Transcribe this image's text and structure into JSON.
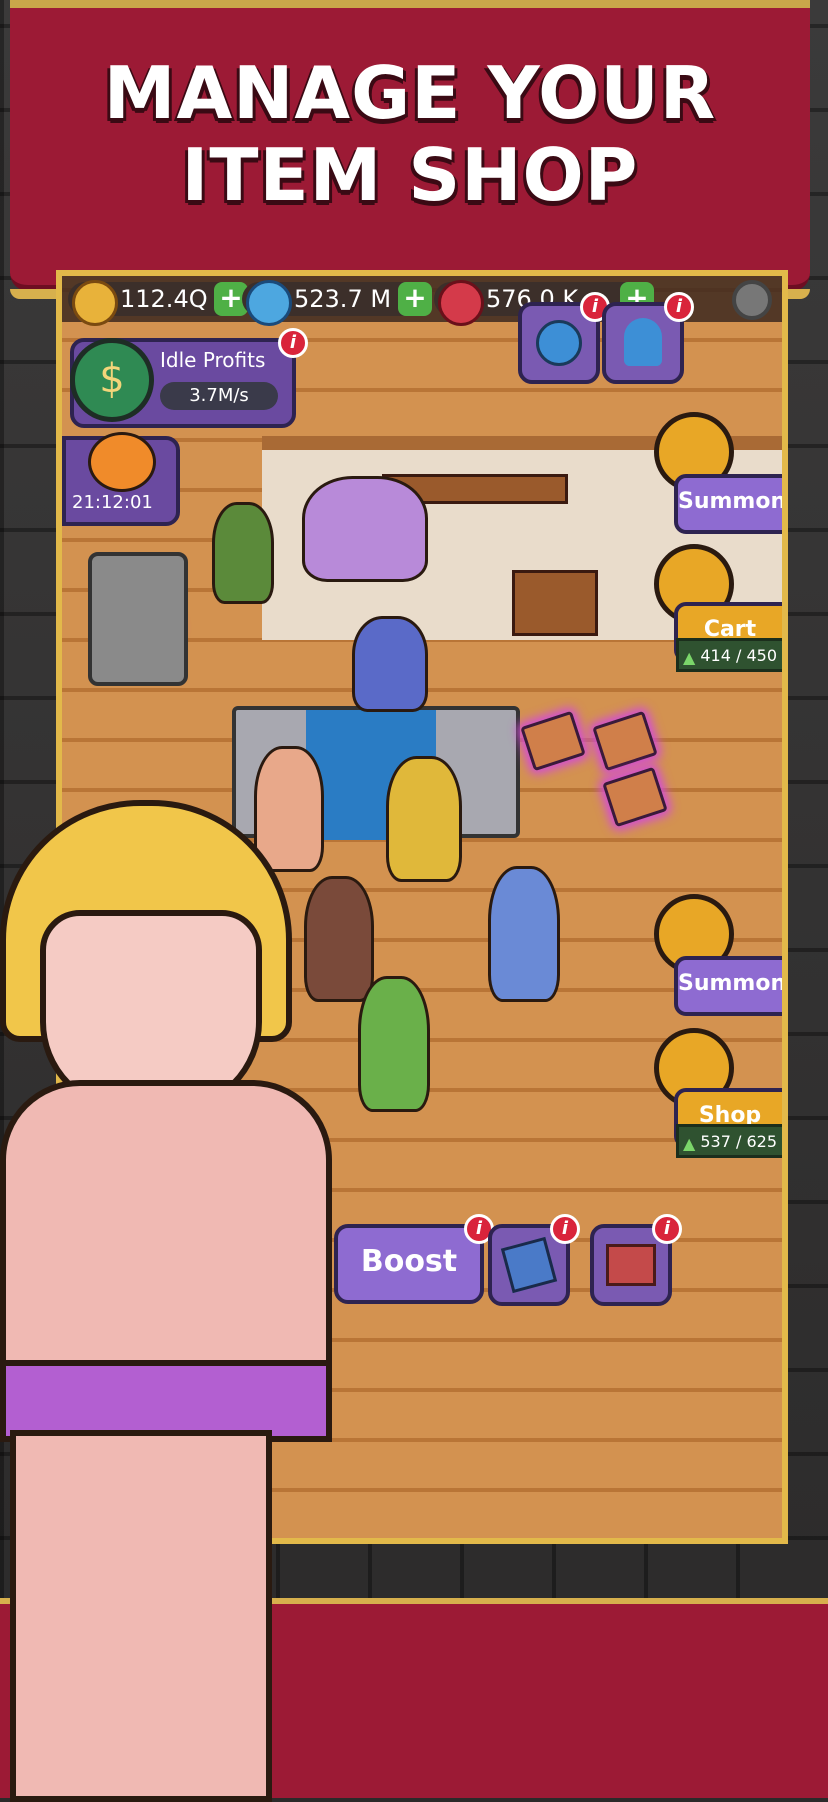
{
  "banner": {
    "title_line1": "MANAGE YOUR",
    "title_line2": "ITEM SHOP"
  },
  "topbar": {
    "coins": {
      "value": "112.4Q",
      "icon": "coin-icon"
    },
    "gems": {
      "value": "523.7 M",
      "icon": "gem-icon"
    },
    "rubies": {
      "value": "576.0 K",
      "icon": "ruby-icon"
    },
    "settings_icon": "gear-icon"
  },
  "idle_profits": {
    "label": "Idle Profits",
    "value": "3.7M/s"
  },
  "event_timer": {
    "value": "21:12:01"
  },
  "right_panel": {
    "summon_top": {
      "label": "Summon"
    },
    "cart": {
      "label": "Cart",
      "counter": "414 / 450"
    },
    "summon_bottom": {
      "label": "Summon"
    },
    "shop": {
      "label": "Shop",
      "counter": "537 / 625"
    }
  },
  "bottom_bar": {
    "boost_label": "Boost"
  },
  "info_mark": "i",
  "colors": {
    "accent_red": "#9c1a35",
    "gold": "#d7b04d",
    "purple_button": "#7a5ab2",
    "green_plus": "#4fb046"
  }
}
